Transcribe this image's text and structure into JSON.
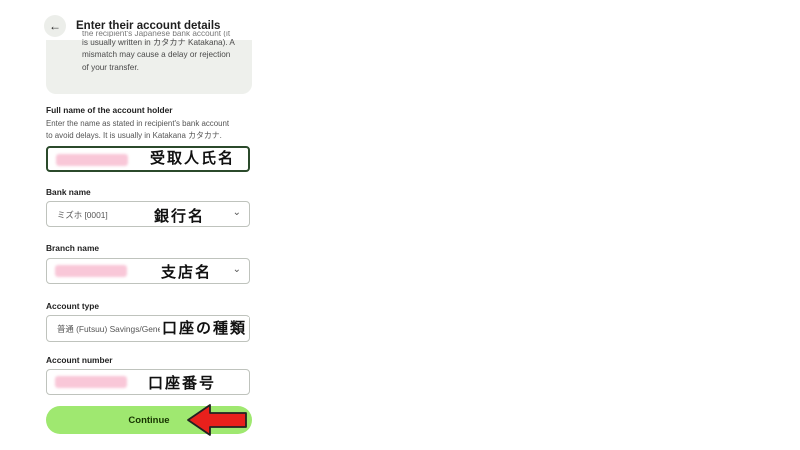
{
  "header": {
    "title": "Enter their account details",
    "back_icon": "←"
  },
  "info": {
    "lines": [
      "the recipient's Japanese bank account (it",
      "is usually written in カタカナ Katakana). A",
      "mismatch may cause a delay or rejection",
      "of your transfer."
    ]
  },
  "full_name": {
    "label": "Full name of the account holder",
    "help": [
      "Enter the name as stated in recipient's bank account",
      "to avoid delays. It is usually in Katakana カタカナ."
    ],
    "annotation": "受取人氏名"
  },
  "bank": {
    "label": "Bank name",
    "value": "ミズホ [0001]",
    "annotation": "銀行名",
    "chevron": "⌄"
  },
  "branch": {
    "label": "Branch name",
    "annotation": "支店名",
    "chevron": "⌄"
  },
  "account_type": {
    "label": "Account type",
    "value": "普通 (Futsuu) Savings/General",
    "annotation": "口座の種類"
  },
  "account_number": {
    "label": "Account number",
    "annotation": "口座番号"
  },
  "continue_label": "Continue",
  "colors": {
    "accent": "#9fe870",
    "arrow": "#e8201c",
    "redaction": "#f9c7d8"
  }
}
